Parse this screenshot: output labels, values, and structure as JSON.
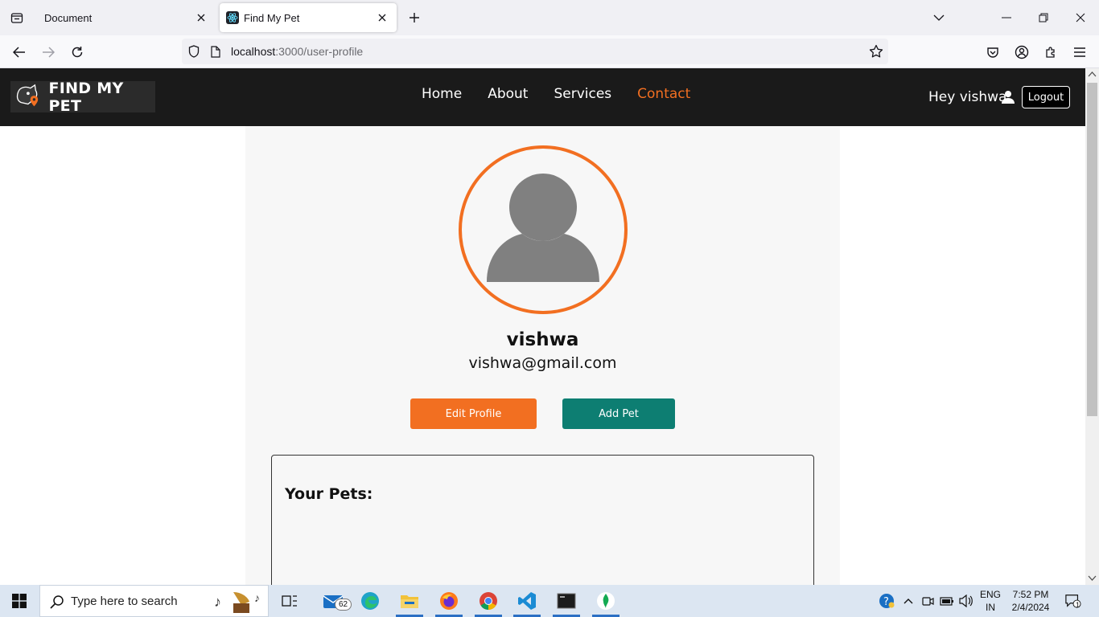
{
  "browser": {
    "tabs": [
      {
        "title": "Document",
        "active": false
      },
      {
        "title": "Find My Pet",
        "active": true
      }
    ],
    "url": {
      "host": "localhost",
      "path": ":3000/user-profile"
    }
  },
  "site": {
    "logo_text": "FIND MY PET",
    "nav": [
      {
        "label": "Home"
      },
      {
        "label": "About"
      },
      {
        "label": "Services"
      },
      {
        "label": "Contact",
        "active": true
      }
    ],
    "greeting": "Hey vishwa",
    "logout_label": "Logout",
    "accent_color": "#f26f21"
  },
  "profile": {
    "name": "vishwa",
    "email": "vishwa@gmail.com",
    "edit_label": "Edit Profile",
    "add_pet_label": "Add Pet",
    "add_pet_color": "#0d7e72",
    "pets_title": "Your Pets:"
  },
  "taskbar": {
    "search_placeholder": "Type here to search",
    "mail_badge": "62",
    "lang_top": "ENG",
    "lang_bottom": "IN",
    "time": "7:52 PM",
    "date": "2/4/2024",
    "notification_count": "1"
  }
}
